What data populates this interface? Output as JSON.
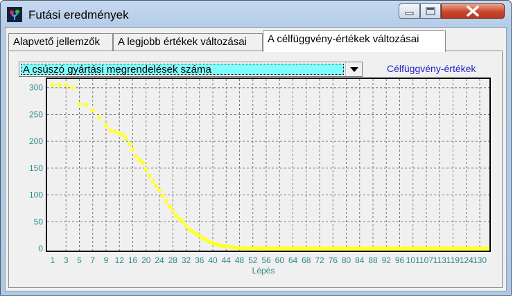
{
  "window": {
    "title": "Futási eredmények"
  },
  "tabs": [
    {
      "label": "Alapvető jellemzők"
    },
    {
      "label": "A legjobb értékek változásai"
    },
    {
      "label": "A célfüggvény-értékek változásai"
    }
  ],
  "dropdown": {
    "value": "A csúszó gyártási megrendelések száma"
  },
  "chart_title": "Célfüggvény-értékek",
  "chart_data": {
    "type": "scatter",
    "title": "Célfüggvény-értékek",
    "xlabel": "Lépés",
    "ylabel": "",
    "ylim": [
      0,
      310
    ],
    "yticks": [
      0,
      50,
      100,
      150,
      200,
      250,
      300
    ],
    "xticks": [
      "1",
      "3",
      "5",
      "7",
      "9",
      "12",
      "16",
      "20",
      "24",
      "28",
      "32",
      "36",
      "40",
      "44",
      "48",
      "52",
      "56",
      "60",
      "64",
      "68",
      "72",
      "76",
      "80",
      "84",
      "88",
      "92",
      "96",
      "101",
      "107",
      "113",
      "119",
      "124",
      "130"
    ],
    "grid": true,
    "series": [
      {
        "color": "#ffff33",
        "x": [
          1,
          2,
          3,
          4,
          5,
          6,
          7,
          8,
          9,
          10,
          11,
          12,
          13,
          14,
          15,
          16,
          17,
          18,
          19,
          20,
          21,
          22,
          23,
          24,
          25,
          26,
          27,
          28,
          29,
          30,
          31,
          32,
          33,
          34,
          35,
          36,
          37,
          38,
          39,
          40,
          41,
          42,
          43,
          44,
          45,
          46,
          47,
          48,
          49,
          50,
          51,
          52,
          53,
          54,
          55,
          56,
          60,
          70,
          80,
          90,
          100,
          110,
          120,
          130,
          134
        ],
        "y": [
          305,
          305,
          305,
          300,
          270,
          268,
          258,
          245,
          230,
          220,
          218,
          215,
          212,
          205,
          195,
          185,
          172,
          165,
          160,
          148,
          136,
          125,
          117,
          108,
          98,
          88,
          79,
          70,
          61,
          55,
          50,
          43,
          35,
          31,
          28,
          24,
          19,
          16,
          13,
          10,
          8,
          6,
          5,
          4,
          3,
          2,
          1,
          1,
          0.5,
          0.3,
          0.2,
          0.1,
          0,
          0,
          0,
          0,
          0,
          0,
          0,
          0,
          0,
          0,
          0,
          0,
          0
        ]
      }
    ]
  }
}
